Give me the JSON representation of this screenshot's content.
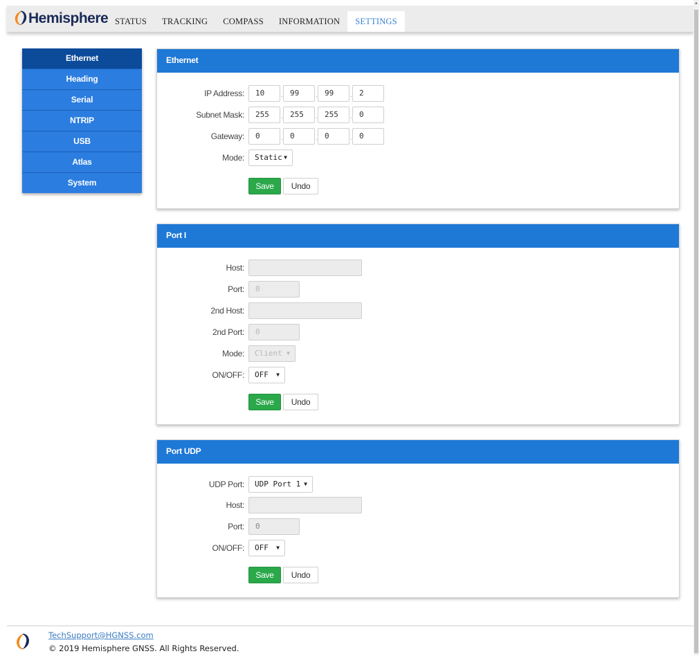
{
  "brand": {
    "name": "Hemisphere",
    "logo_icon": "hemisphere-swirl-logo",
    "accent": "#f28c1e",
    "navy": "#1a2a57"
  },
  "nav": {
    "items": [
      "STATUS",
      "TRACKING",
      "COMPASS",
      "INFORMATION",
      "SETTINGS"
    ],
    "active": "SETTINGS"
  },
  "sidebar": {
    "items": [
      "Ethernet",
      "Heading",
      "Serial",
      "NTRIP",
      "USB",
      "Atlas",
      "System"
    ],
    "active": "Ethernet"
  },
  "ethernet": {
    "title": "Ethernet",
    "ip_label": "IP Address:",
    "ip": [
      "10",
      "99",
      "99",
      "2"
    ],
    "subnet_label": "Subnet Mask:",
    "subnet": [
      "255",
      "255",
      "255",
      "0"
    ],
    "gateway_label": "Gateway:",
    "gateway": [
      "0",
      "0",
      "0",
      "0"
    ],
    "mode_label": "Mode:",
    "mode_value": "Static",
    "save": "Save",
    "undo": "Undo"
  },
  "port_i": {
    "title": "Port I",
    "host_label": "Host:",
    "host_value": "",
    "port_label": "Port:",
    "port_placeholder": "0",
    "host2_label": "2nd Host:",
    "host2_value": "",
    "port2_label": "2nd Port:",
    "port2_placeholder": "0",
    "mode_label": "Mode:",
    "mode_value": "Client",
    "onoff_label": "ON/OFF:",
    "onoff_value": "OFF",
    "save": "Save",
    "undo": "Undo"
  },
  "port_udp": {
    "title": "Port UDP",
    "udp_label": "UDP Port:",
    "udp_value": "UDP Port 1",
    "host_label": "Host:",
    "host_value": "",
    "port_label": "Port:",
    "port_value": "0",
    "onoff_label": "ON/OFF:",
    "onoff_value": "OFF",
    "save": "Save",
    "undo": "Undo"
  },
  "footer": {
    "link": "TechSupport@HGNSS.com",
    "copyright": "© 2019 Hemisphere GNSS. All Rights Reserved."
  },
  "colors": {
    "panel_header": "#1e78d6",
    "side_item": "#2b7de0",
    "side_active": "#0c4a9a",
    "save_button": "#2aa84a",
    "nav_active_text": "#3a82d6"
  }
}
